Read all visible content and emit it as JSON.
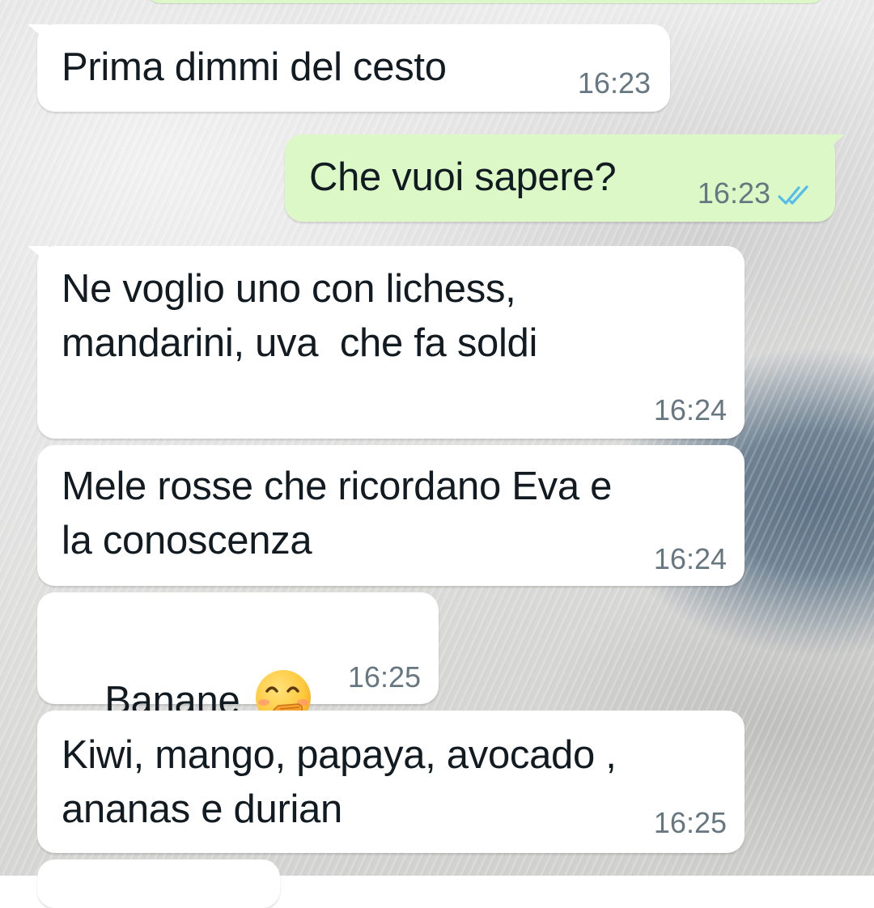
{
  "chat": {
    "messages": [
      {
        "direction": "incoming",
        "text": "Prima dimmi del cesto",
        "time": "16:23"
      },
      {
        "direction": "outgoing",
        "text": "Che vuoi sapere?",
        "time": "16:23",
        "status": "read-double-check"
      },
      {
        "direction": "incoming",
        "text": "Ne voglio uno con lichess,\nmandarini, uva  che fa soldi",
        "time": "16:24"
      },
      {
        "direction": "incoming",
        "text": "Mele rosse che ricordano Eva e\nla conoscenza",
        "time": "16:24"
      },
      {
        "direction": "incoming",
        "text": "Banane",
        "emoji": "face-with-hand-over-mouth-emoji",
        "time": "16:25"
      },
      {
        "direction": "incoming",
        "text": "Kiwi, mango, papaya, avocado ,\nananas e durian",
        "time": "16:25"
      }
    ]
  },
  "colors": {
    "incoming_bubble": "#ffffff",
    "outgoing_bubble": "#dcf8c6",
    "timestamp": "#667781",
    "read_tick": "#53bdeb",
    "text": "#111b21"
  }
}
